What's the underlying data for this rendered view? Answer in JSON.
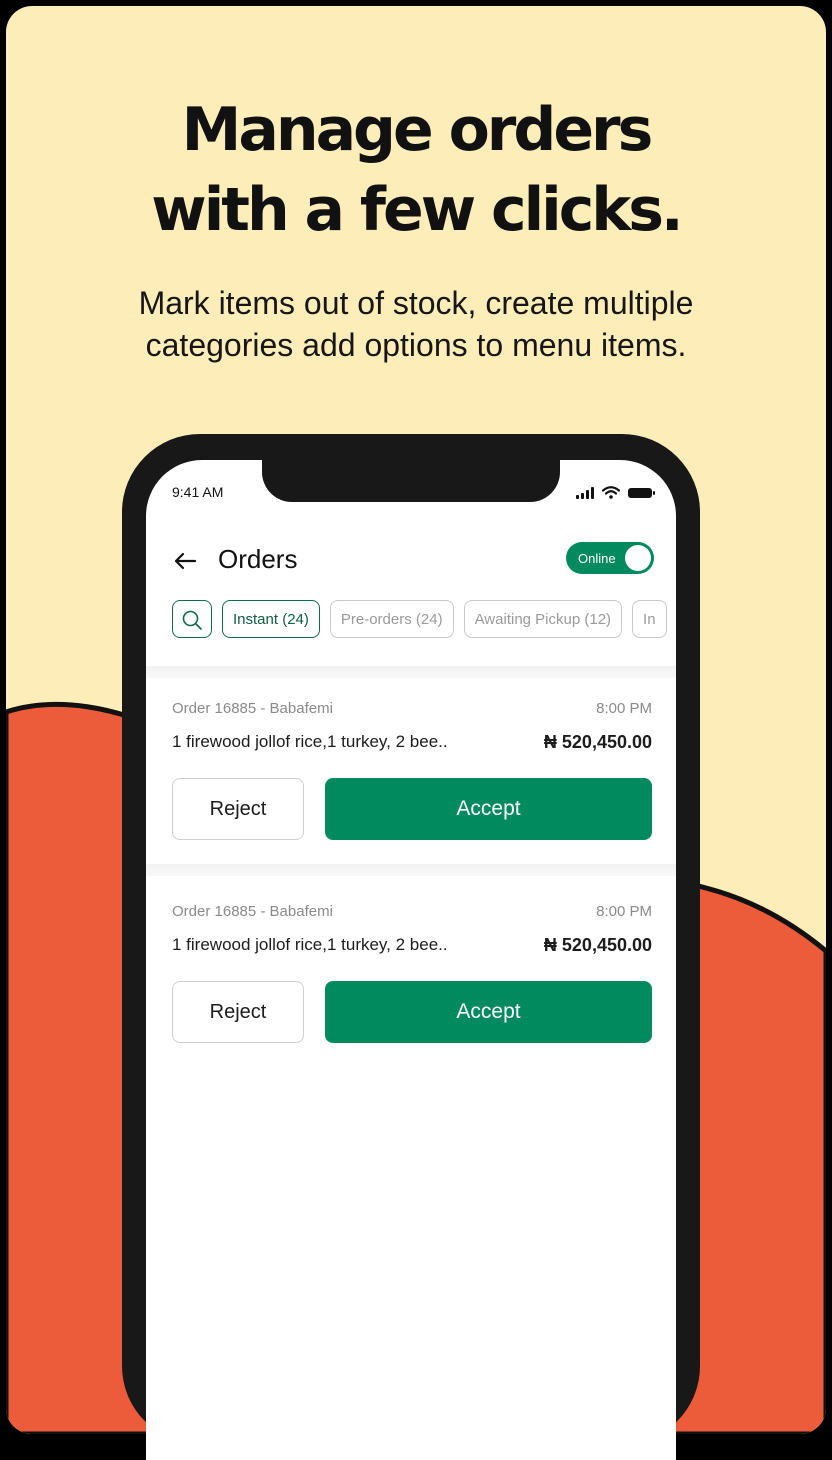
{
  "headline": {
    "line1": "Manage orders",
    "line2": "with a few clicks."
  },
  "subheadline": {
    "line1": "Mark items out of stock, create multiple",
    "line2": "categories add options to menu items."
  },
  "colors": {
    "background": "#FDEDB9",
    "wave": "#EC5C3B",
    "accent": "#028A5F",
    "phone_frame": "#171817"
  },
  "status_bar": {
    "time": "9:41 AM",
    "icons": [
      "signal-icon",
      "wifi-icon",
      "battery-icon"
    ]
  },
  "header": {
    "back_icon": "arrow-left-icon",
    "title": "Orders",
    "toggle_label": "Online",
    "toggle_on": true
  },
  "filters": {
    "search_icon": "search-icon",
    "chips": [
      {
        "label": "Instant (24)",
        "active": true
      },
      {
        "label": "Pre-orders (24)",
        "active": false
      },
      {
        "label": "Awaiting Pickup (12)",
        "active": false
      },
      {
        "label": "In",
        "active": false
      }
    ]
  },
  "orders": [
    {
      "meta": "Order 16885 - Babafemi",
      "time": "8:00 PM",
      "items": "1 firewood jollof rice,1 turkey, 2 bee..",
      "price": "₦ 520,450.00",
      "reject_label": "Reject",
      "accept_label": "Accept"
    },
    {
      "meta": "Order 16885 - Babafemi",
      "time": "8:00 PM",
      "items": "1 firewood jollof rice,1 turkey, 2 bee..",
      "price": "₦ 520,450.00",
      "reject_label": "Reject",
      "accept_label": "Accept"
    }
  ]
}
